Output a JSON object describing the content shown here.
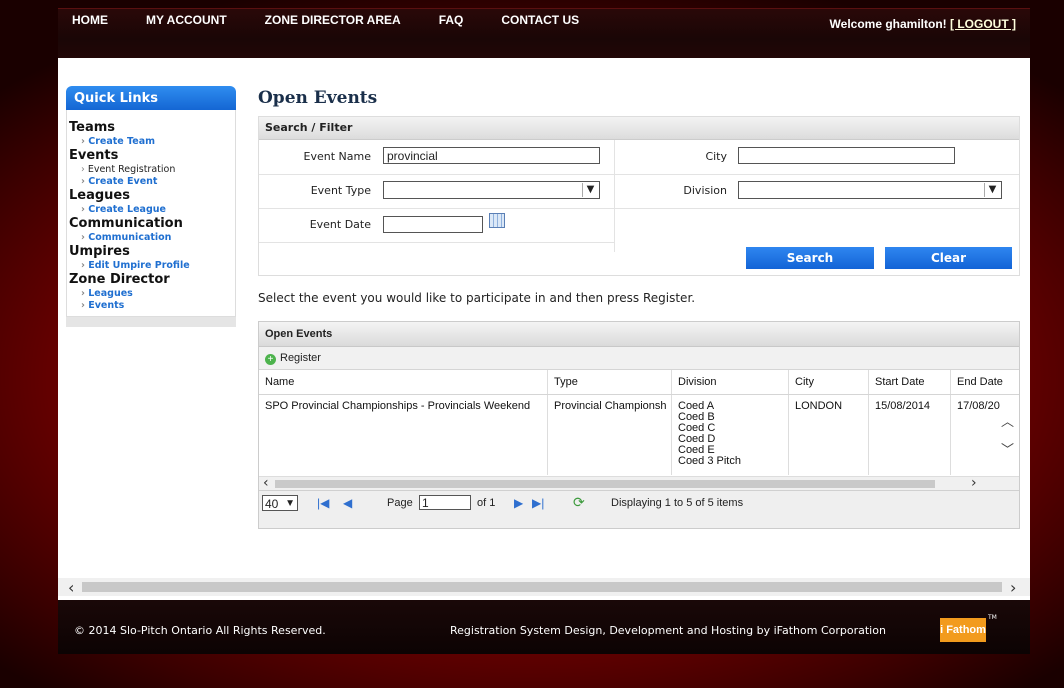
{
  "nav": {
    "items": [
      "HOME",
      "MY ACCOUNT",
      "ZONE DIRECTOR AREA",
      "FAQ",
      "CONTACT US"
    ],
    "welcome_prefix": "Welcome ghamilton!",
    "logout": "[ LOGOUT ]"
  },
  "sidebar": {
    "title": "Quick Links",
    "sections": [
      {
        "heading": "Teams",
        "links": [
          {
            "label": "Create Team",
            "bold": true
          }
        ]
      },
      {
        "heading": "Events",
        "links": [
          {
            "label": "Event Registration",
            "bold": false
          },
          {
            "label": "Create Event",
            "bold": true
          }
        ]
      },
      {
        "heading": "Leagues",
        "links": [
          {
            "label": "Create League",
            "bold": true
          }
        ]
      },
      {
        "heading": "Communication",
        "links": [
          {
            "label": "Communication",
            "bold": true
          }
        ]
      },
      {
        "heading": "Umpires",
        "links": [
          {
            "label": "Edit Umpire Profile",
            "bold": true
          }
        ]
      },
      {
        "heading": "Zone Director",
        "links": [
          {
            "label": "Leagues",
            "bold": true
          },
          {
            "label": "Events",
            "bold": true
          }
        ]
      }
    ]
  },
  "page": {
    "title": "Open Events",
    "instruction": "Select the event you would like to participate in and then press Register."
  },
  "filter": {
    "title": "Search / Filter",
    "event_name_label": "Event Name",
    "event_name_value": "provincial",
    "city_label": "City",
    "city_value": "",
    "event_type_label": "Event Type",
    "event_type_value": "",
    "division_label": "Division",
    "division_value": "",
    "event_date_label": "Event Date",
    "event_date_value": "",
    "search_button": "Search",
    "clear_button": "Clear"
  },
  "grid": {
    "title": "Open Events",
    "register_label": "Register",
    "columns": [
      "Name",
      "Type",
      "Division",
      "City",
      "Start Date",
      "End Date"
    ],
    "rows": [
      {
        "name": "SPO Provincial Championships - Provincials Weekend",
        "type": "Provincial Championsh",
        "divisions": [
          "Coed A",
          "Coed B",
          "Coed C",
          "Coed D",
          "Coed E",
          "Coed 3 Pitch"
        ],
        "city": "LONDON",
        "start": "15/08/2014",
        "end": "17/08/20"
      }
    ],
    "pager": {
      "page_size": "40",
      "page_label": "Page",
      "page_value": "1",
      "of_label": "of 1",
      "display_text": "Displaying 1 to 5 of 5 items"
    }
  },
  "footer": {
    "copyright": "© 2014 Slo-Pitch Ontario All Rights Reserved.",
    "credit": "Registration System Design, Development and Hosting by iFathom Corporation",
    "logo_text": "i Fathom",
    "tm": "TM"
  }
}
